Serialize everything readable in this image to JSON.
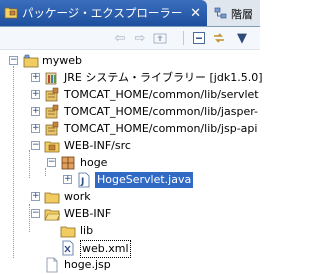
{
  "tabs": {
    "active_label": "パッケージ・エクスプローラー",
    "close_glyph": "✕",
    "inactive_label": "階層"
  },
  "toolbar": {
    "back_icon": "back-arrow-icon",
    "forward_icon": "forward-arrow-icon",
    "up_icon": "up-folder-icon",
    "collapse_icon": "collapse-all-icon",
    "link_icon": "link-with-editor-icon",
    "menu_icon": "view-menu-icon"
  },
  "tree": {
    "items": [
      {
        "label": "myweb"
      },
      {
        "label": "JRE システム・ライブラリー [jdk1.5.0]"
      },
      {
        "label": "TOMCAT_HOME/common/lib/servlet"
      },
      {
        "label": "TOMCAT_HOME/common/lib/jasper-"
      },
      {
        "label": "TOMCAT_HOME/common/lib/jsp-api"
      },
      {
        "label": "WEB-INF/src"
      },
      {
        "label": "hoge"
      },
      {
        "label": "HogeServlet.java"
      },
      {
        "label": "work"
      },
      {
        "label": "WEB-INF"
      },
      {
        "label": "lib"
      },
      {
        "label": "web.xml"
      },
      {
        "label": "hoge.jsp"
      }
    ]
  },
  "colors": {
    "tab_active": "#2a5fae",
    "selection": "#316ac5",
    "folder": "#e8c15a",
    "package": "#c5843c"
  }
}
